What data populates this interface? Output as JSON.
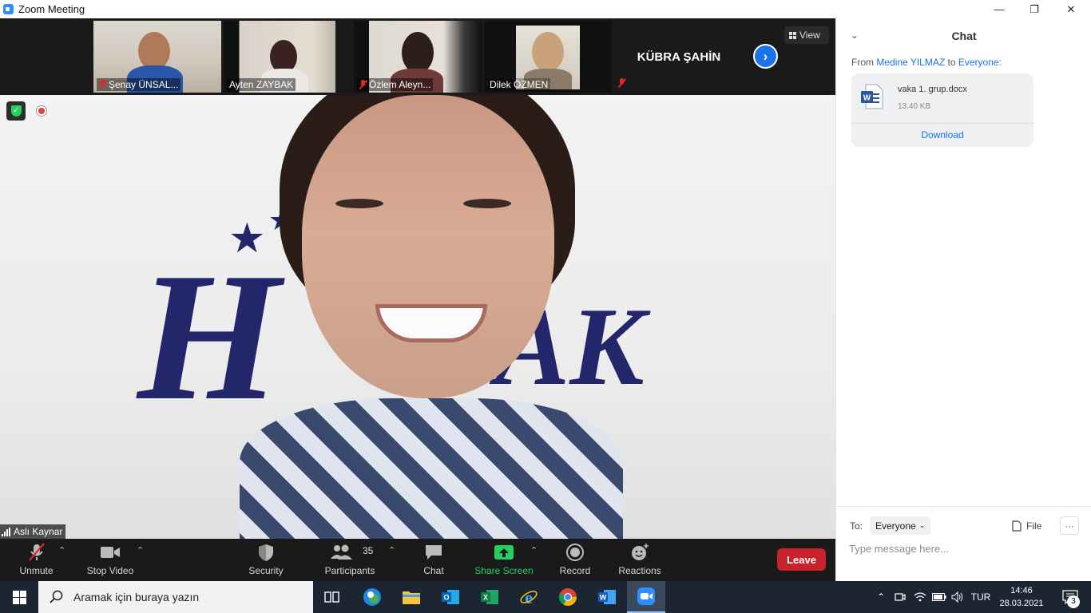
{
  "window": {
    "title": "Zoom Meeting",
    "controls": {
      "minimize": "—",
      "restore": "❐",
      "close": "✕"
    }
  },
  "gallery": {
    "participants": [
      {
        "name": "Şenay ÜNSAL...",
        "muted": true
      },
      {
        "name": "Ayten ZAYBAK",
        "muted": false
      },
      {
        "name": "Özlem Aleyn...",
        "muted": true
      },
      {
        "name": "Dilek ÖZMEN",
        "muted": false
      }
    ],
    "name_tile": {
      "name": "KÜBRA ŞAHİN",
      "muted": true
    },
    "next_label": "›",
    "view_label": "View"
  },
  "main_video": {
    "speaker_name": "Aslı Kaynar",
    "background_logo_left": "H",
    "background_logo_right": "AK"
  },
  "toolbar": {
    "unmute": "Unmute",
    "stop_video": "Stop Video",
    "security": "Security",
    "participants": "Participants",
    "participants_count": "35",
    "chat": "Chat",
    "share_screen": "Share Screen",
    "record": "Record",
    "reactions": "Reactions",
    "leave": "Leave",
    "caret": "⌃"
  },
  "chat": {
    "title": "Chat",
    "collapse_icon": "⌄",
    "from_prefix": "From ",
    "from_user": "Medine YILMAZ",
    "to_word": " to ",
    "to_target": "Everyone:",
    "file": {
      "name": "vaka 1. grup.docx",
      "size": "13.40 KB",
      "download": "Download"
    },
    "to_label": "To:",
    "to_value": "Everyone",
    "file_button": "File",
    "more_button": "···",
    "input_placeholder": "Type message here..."
  },
  "taskbar": {
    "search_placeholder": "Aramak için buraya yazın",
    "language": "TUR",
    "time": "14:46",
    "date": "28.03.2021",
    "notifications_count": "3",
    "apps": [
      "task-view",
      "edge",
      "file-explorer",
      "outlook",
      "excel",
      "internet-explorer",
      "chrome",
      "word",
      "zoom"
    ]
  },
  "colors": {
    "zoom_blue": "#2d8cff",
    "share_green": "#23d160",
    "leave_red": "#c8232c",
    "link_blue": "#1a73e8",
    "logo_navy": "#23266b"
  }
}
